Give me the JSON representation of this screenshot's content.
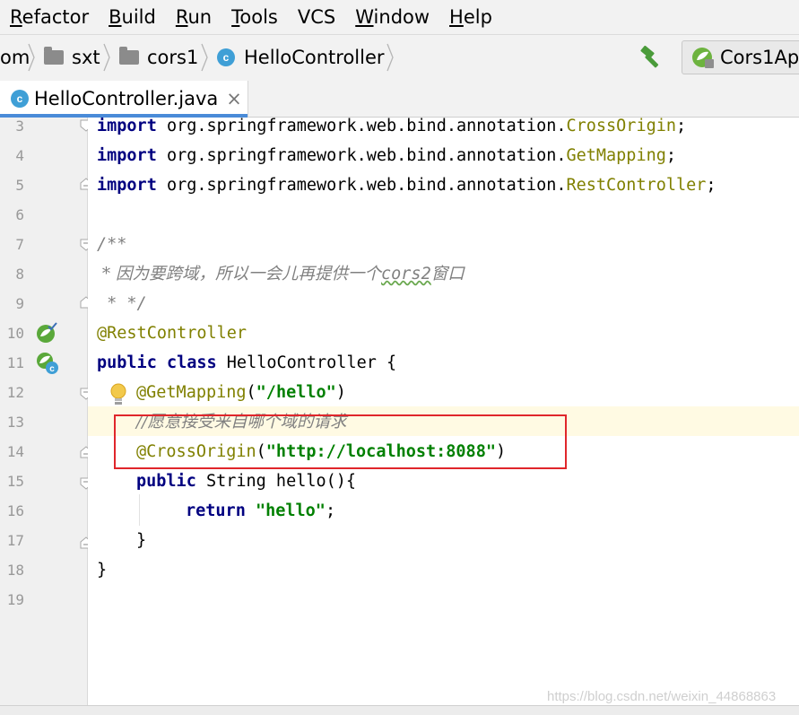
{
  "menu": [
    {
      "mnemonic": "R",
      "rest": "efactor"
    },
    {
      "mnemonic": "B",
      "rest": "uild"
    },
    {
      "mnemonic": "R",
      "rest": "un"
    },
    {
      "mnemonic": "T",
      "rest": "ools"
    },
    {
      "mnemonic": "",
      "rest": "VCS"
    },
    {
      "mnemonic": "W",
      "rest": "indow"
    },
    {
      "mnemonic": "H",
      "rest": "elp"
    }
  ],
  "nav": {
    "crumb_root": "om",
    "crumb_1": "sxt",
    "crumb_2": "cors1",
    "crumb_3": "HelloController",
    "run_config": "Cors1Ap"
  },
  "tab": {
    "title": "HelloController.java",
    "close": "×"
  },
  "icons": {
    "class_icon_letter": "c"
  },
  "code": {
    "l3": {
      "kw": "import",
      "pkg": " org.springframework.web.bind.annotation.",
      "cls": "CrossOrigin",
      "end": ";"
    },
    "l4": {
      "kw": "import",
      "pkg": " org.springframework.web.bind.annotation.",
      "cls": "GetMapping",
      "end": ";"
    },
    "l5": {
      "kw": "import",
      "pkg": " org.springframework.web.bind.annotation.",
      "cls": "RestController",
      "end": ";"
    },
    "l7": "/**",
    "l8": {
      "pre": " * 因为要跨域，所以一会儿再提供一个",
      "wavy": "cors2",
      "post": "窗口"
    },
    "l9": " * */",
    "l10": "@RestController",
    "l11": {
      "kw": "public class",
      "rest": " HelloController {"
    },
    "l12": {
      "ann": "@GetMapping",
      "open": "(",
      "str": "\"/hello\"",
      "close": ")"
    },
    "l13": "//愿意接受来自哪个域的请求",
    "l14": {
      "ann": "@CrossOrigin",
      "open": "(",
      "str": "\"http://localhost:8088\"",
      "close": ")"
    },
    "l15": {
      "kw": "public",
      "rest": " String hello(){"
    },
    "l16": {
      "kw": "return",
      "sp": " ",
      "str": "\"hello\"",
      "end": ";"
    },
    "l17": "}",
    "l18": "}"
  },
  "line_numbers": [
    "3",
    "4",
    "5",
    "6",
    "7",
    "8",
    "9",
    "10",
    "11",
    "12",
    "13",
    "14",
    "15",
    "16",
    "17",
    "18",
    "19"
  ],
  "watermark": "https://blog.csdn.net/weixin_44868863",
  "colors": {
    "keyword": "#000080",
    "annotation": "#808000",
    "string": "#008000",
    "comment": "#808080",
    "highlight_box": "#e0262b",
    "tab_accent": "#4a8bd8"
  }
}
